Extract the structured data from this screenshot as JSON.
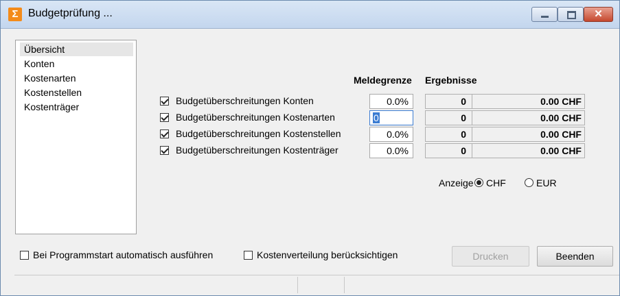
{
  "window": {
    "title": "Budgetprüfung ...",
    "icon": "sigma-app-icon",
    "controls": {
      "minimize": "minimize-icon",
      "maximize": "maximize-icon",
      "close": "close-icon"
    }
  },
  "sidebar": {
    "items": [
      {
        "label": "Übersicht",
        "selected": true
      },
      {
        "label": "Konten"
      },
      {
        "label": "Kostenarten"
      },
      {
        "label": "Kostenstellen"
      },
      {
        "label": "Kostenträger"
      }
    ]
  },
  "headers": {
    "threshold": "Meldegrenze",
    "results": "Ergebnisse"
  },
  "rows": [
    {
      "label": "Budgetüberschreitungen Konten",
      "checked": true,
      "threshold": "0.0%",
      "count": "0",
      "amount": "0.00 CHF"
    },
    {
      "label": "Budgetüberschreitungen Kostenarten",
      "checked": true,
      "threshold": "0",
      "count": "0",
      "amount": "0.00 CHF",
      "editing": true
    },
    {
      "label": "Budgetüberschreitungen Kostenstellen",
      "checked": true,
      "threshold": "0.0%",
      "count": "0",
      "amount": "0.00 CHF"
    },
    {
      "label": "Budgetüberschreitungen Kostenträger",
      "checked": true,
      "threshold": "0.0%",
      "count": "0",
      "amount": "0.00 CHF"
    }
  ],
  "display": {
    "label": "Anzeige",
    "options": [
      {
        "label": "CHF",
        "selected": true
      },
      {
        "label": "EUR",
        "selected": false
      }
    ]
  },
  "bottom": {
    "autorun_label": "Bei Programmstart automatisch ausführen",
    "autorun_checked": false,
    "distribution_label": "Kostenverteilung berücksichtigen",
    "distribution_checked": false,
    "print_label": "Drucken",
    "print_enabled": false,
    "close_label": "Beenden"
  },
  "colors": {
    "titlebar": "#c3d6ee",
    "close_button": "#c5482e",
    "accent": "#3b7cd2"
  }
}
